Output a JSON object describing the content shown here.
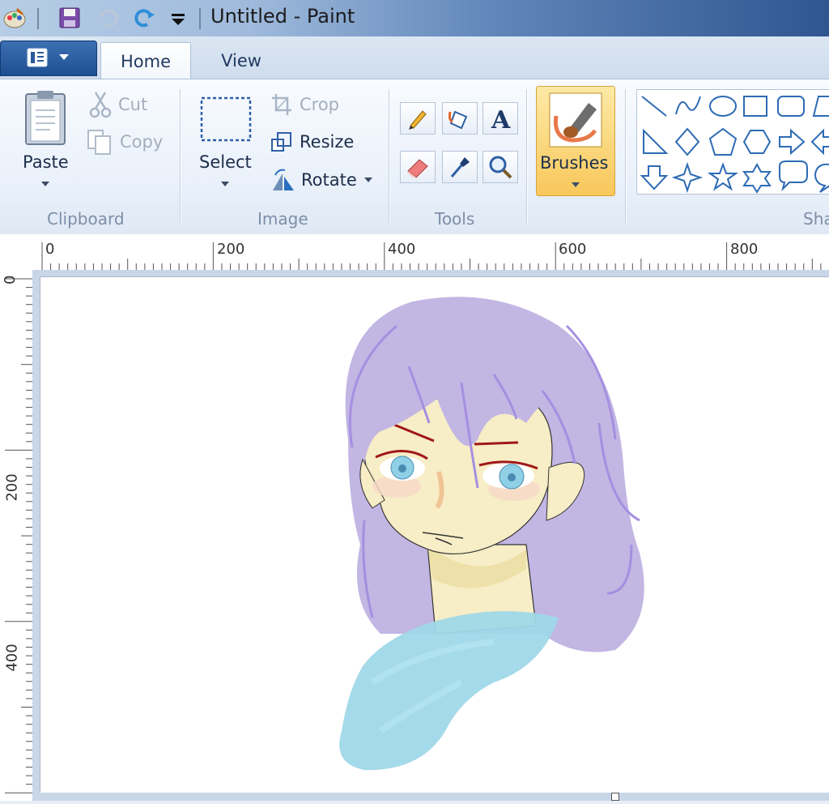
{
  "window": {
    "title": "Untitled - Paint"
  },
  "tabs": [
    {
      "label": "Home",
      "active": true
    },
    {
      "label": "View",
      "active": false
    }
  ],
  "ribbon": {
    "clipboard": {
      "group_label": "Clipboard",
      "paste": "Paste",
      "cut": "Cut",
      "copy": "Copy"
    },
    "image": {
      "group_label": "Image",
      "select": "Select",
      "crop": "Crop",
      "resize": "Resize",
      "rotate": "Rotate"
    },
    "tools": {
      "group_label": "Tools"
    },
    "brushes": {
      "label": "Brushes"
    },
    "shapes": {
      "group_label": "Sha"
    }
  },
  "rulers": {
    "horizontal": [
      "0",
      "200",
      "400",
      "600",
      "800"
    ],
    "vertical": [
      "0",
      "200",
      "400"
    ]
  },
  "colors": {
    "accent": "#f8c85b",
    "hair": "#c2b6e3",
    "skin": "#f7edc6",
    "shirt": "#9fd8e8"
  }
}
